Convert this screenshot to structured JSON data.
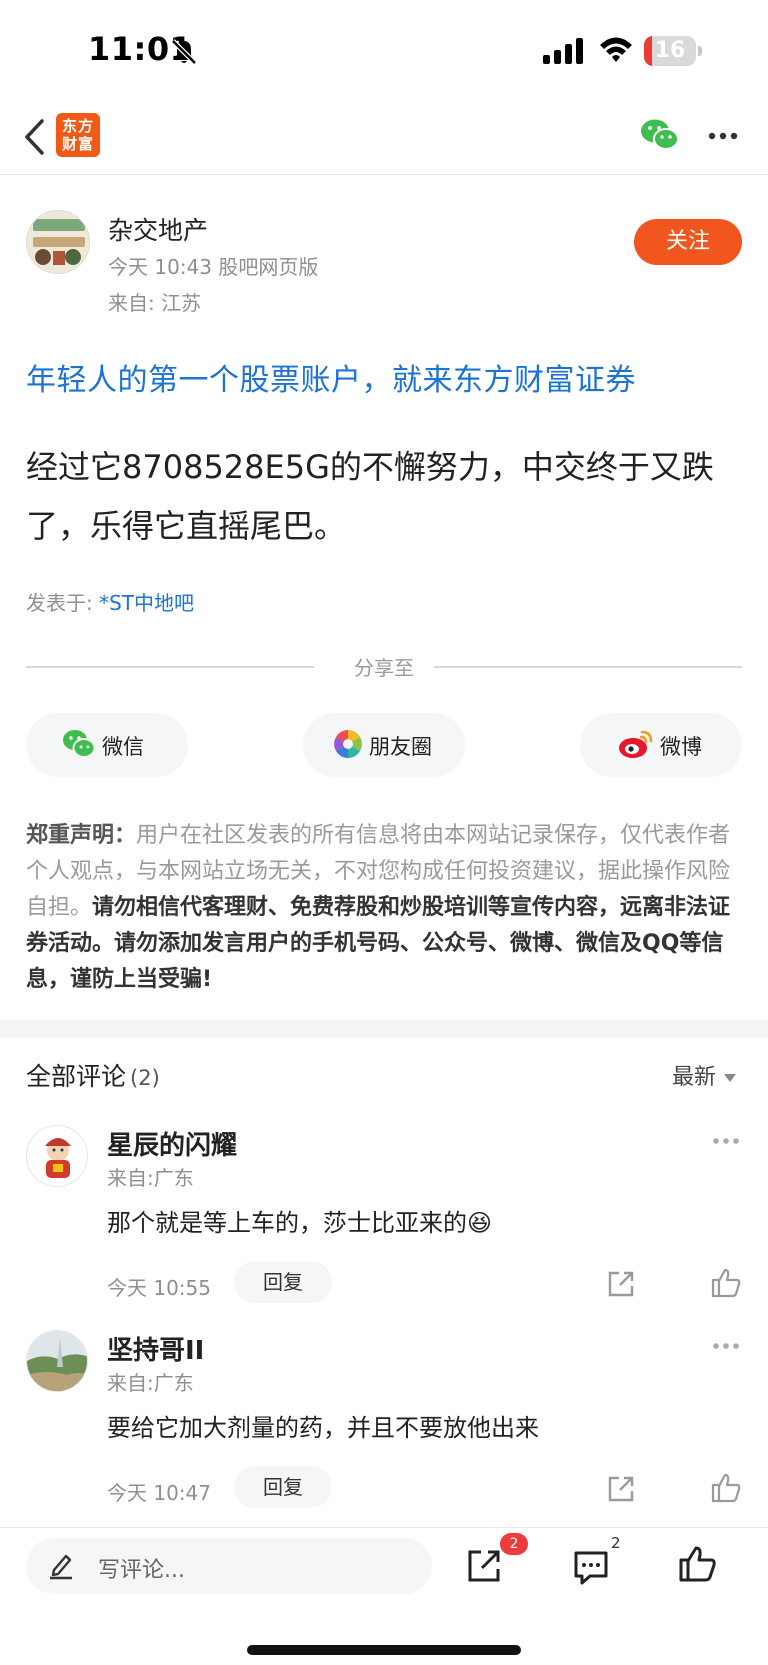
{
  "status_bar": {
    "time": "11:01",
    "battery": "16",
    "battery_level": 0.16
  },
  "nav": {
    "logo_line1": "东方",
    "logo_line2": "财富"
  },
  "post": {
    "author_name": "杂交地产",
    "time": "今天 10:43 股吧网页版",
    "location": "来自: 江苏",
    "follow_label": "关注",
    "ad_link": "年轻人的第一个股票账户，就来东方财富证券",
    "content": "经过它8708528E5G的不懈努力，中交终于又跌了，乐得它直摇尾巴。",
    "posted_in_label": "发表于: ",
    "posted_in_bar": "*ST中地吧"
  },
  "share": {
    "label": "分享至",
    "wechat": "微信",
    "moments": "朋友圈",
    "weibo": "微博"
  },
  "disclaimer": {
    "title": "郑重声明：",
    "normal_text": "用户在社区发表的所有信息将由本网站记录保存，仅代表作者个人观点，与本网站立场无关，不对您构成任何投资建议，据此操作风险自担。",
    "bold_text": "请勿相信代客理财、免费荐股和炒股培训等宣传内容，远离非法证券活动。请勿添加发言用户的手机号码、公众号、微博、微信及QQ等信息，谨防上当受骗!"
  },
  "comments": {
    "header": "全部评论",
    "count": "(2)",
    "sort_label": "最新",
    "reply_label": "回复",
    "items": [
      {
        "name": "星辰的闪耀",
        "location": "来自:广东",
        "text": "那个就是等上车的，莎士比亚来的",
        "emoji": "😆",
        "time": "今天 10:55"
      },
      {
        "name": "坚持哥II",
        "location": "来自:广东",
        "text": "要给它加大剂量的药，并且不要放他出来",
        "emoji": "",
        "time": "今天 10:47"
      }
    ]
  },
  "bottom_bar": {
    "input_placeholder": "写评论...",
    "share_badge": "2",
    "comment_count": "2"
  },
  "colors": {
    "accent_orange": "#f0561d",
    "link_blue": "#1b73d6",
    "badge_red": "#ee3b3b"
  },
  "icons": [
    "bell-slash-icon",
    "signal-icon",
    "wifi-icon",
    "back-icon",
    "wechat-icon",
    "more-icon",
    "moments-icon",
    "weibo-icon",
    "share-icon",
    "like-icon",
    "comment-icon",
    "pen-icon"
  ]
}
